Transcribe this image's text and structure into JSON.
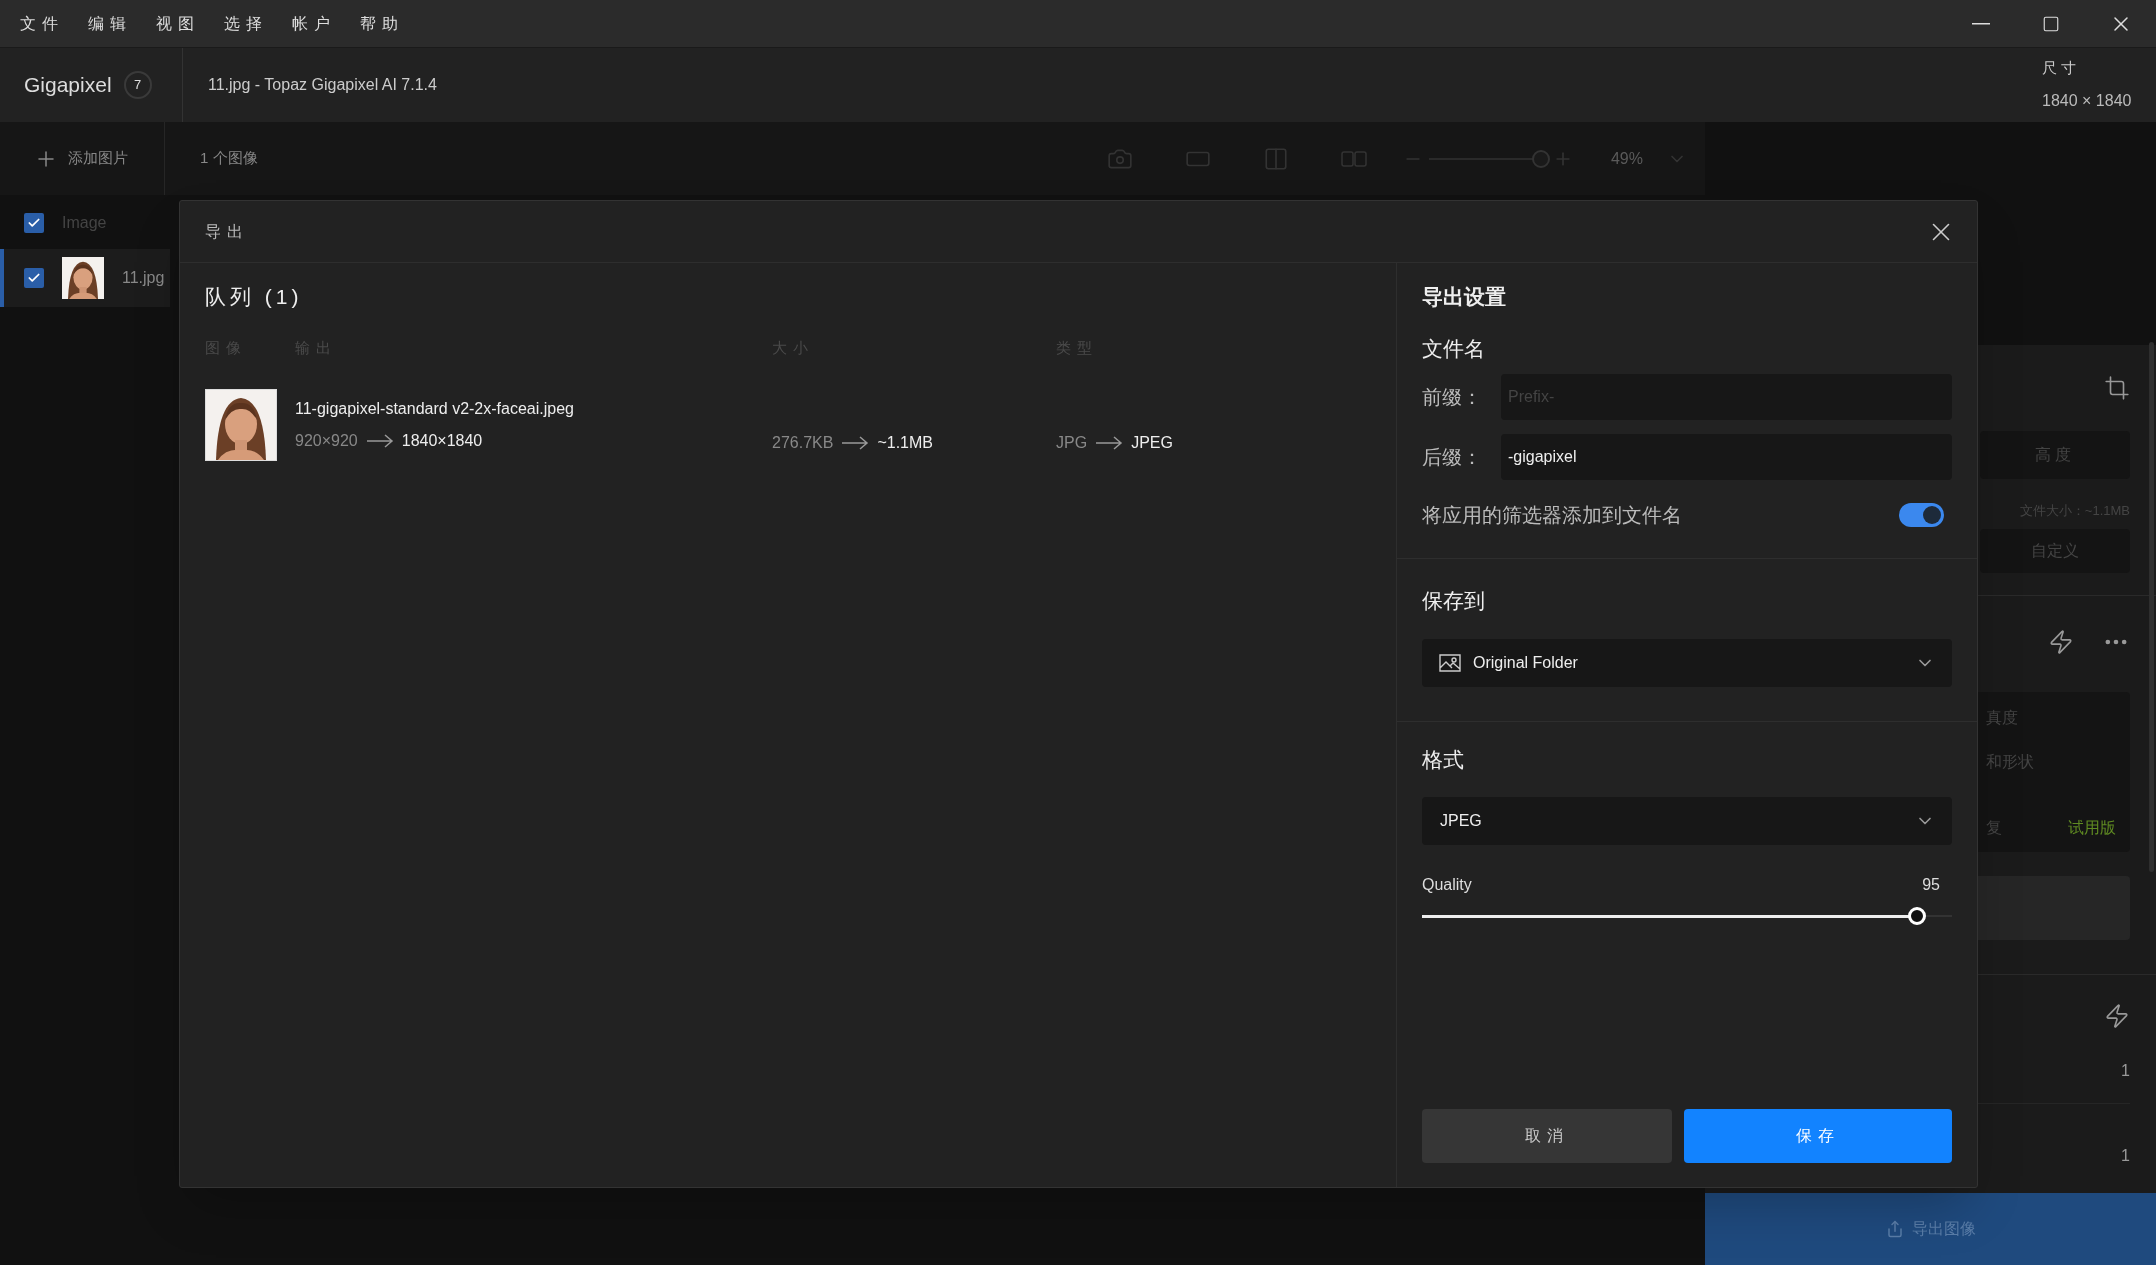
{
  "menu": [
    "文件",
    "编辑",
    "视图",
    "选择",
    "帐户",
    "帮助"
  ],
  "header": {
    "app_name": "Gigapixel",
    "badge": "7",
    "window_title": "11.jpg - Topaz Gigapixel AI 7.1.4",
    "size_label": "尺寸",
    "size_value": "1840 × 1840"
  },
  "toolbar": {
    "add_button": "添加图片",
    "image_count": "1 个图像",
    "zoom": {
      "level": 0.95,
      "reading": "49%"
    }
  },
  "image_list": {
    "header": {
      "label": "Image",
      "checked": true
    },
    "items": [
      {
        "name": "11.jpg",
        "checked": true,
        "selected": true
      }
    ]
  },
  "right_panel": {
    "height_button": "高度",
    "file_size": "文件大小：~1.1MB",
    "custom_button": "自定义",
    "model_lines": [
      "真度",
      "和形状",
      "复"
    ],
    "trial_badge": "试用版",
    "counts": [
      "1",
      "1"
    ],
    "export_button": "导出图像"
  },
  "export_dialog": {
    "title": "导出",
    "queue_title": "队列 (1)",
    "columns": [
      "图像",
      "输出",
      "大小",
      "类型"
    ],
    "rows": [
      {
        "output_name": "11-gigapixel-standard v2-2x-faceai.jpeg",
        "input_dims": "920×920",
        "output_dims": "1840×1840",
        "input_size": "276.7KB",
        "output_size": "~1.1MB",
        "input_type": "JPG",
        "output_type": "JPEG"
      }
    ],
    "settings": {
      "title": "导出设置",
      "filename_title": "文件名",
      "prefix": {
        "label": "前缀：",
        "placeholder": "Prefix-"
      },
      "suffix": {
        "label": "后缀：",
        "value": "-gigapixel"
      },
      "add_filters": {
        "label": "将应用的筛选器添加到文件名",
        "on": true
      },
      "save_to": {
        "title": "保存到",
        "value": "Original Folder"
      },
      "format": {
        "title": "格式",
        "value": "JPEG"
      },
      "quality": {
        "label": "Quality",
        "reading": "95",
        "level": 0.934
      },
      "cancel": "取消",
      "save": "保存"
    }
  }
}
